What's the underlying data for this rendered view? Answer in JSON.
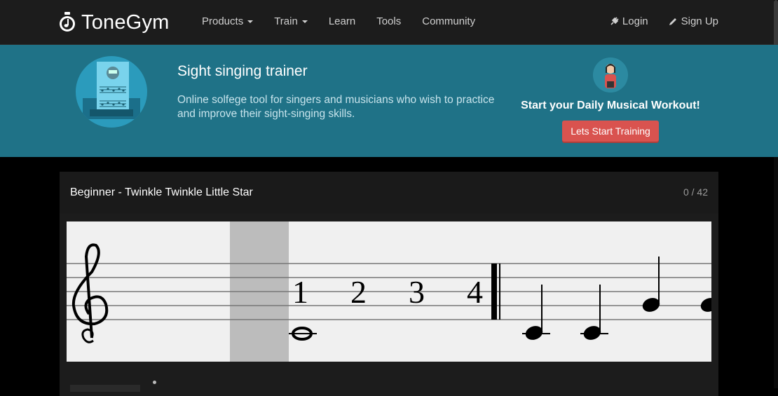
{
  "brand": {
    "name": "ToneGym",
    "icon": "stopwatch-music-note-icon"
  },
  "nav": {
    "items": [
      {
        "label": "Products",
        "dropdown": true
      },
      {
        "label": "Train",
        "dropdown": true
      },
      {
        "label": "Learn",
        "dropdown": false
      },
      {
        "label": "Tools",
        "dropdown": false
      },
      {
        "label": "Community",
        "dropdown": false
      }
    ],
    "login": "Login",
    "signup": "Sign Up"
  },
  "hero": {
    "title": "Sight singing trainer",
    "description": "Online solfege tool for singers and musicians who wish to practice and improve their sight-singing skills.",
    "workout_text": "Start your Daily Musical Workout!",
    "cta_label": "Lets Start Training"
  },
  "exercise": {
    "title": "Beginner - Twinkle Twinkle Little Star",
    "counter": "0 / 42",
    "count_in": [
      "1",
      "2",
      "3",
      "4"
    ]
  },
  "colors": {
    "navbar": "#1c1c1c",
    "hero": "#1f7287",
    "cta": "#d9534f",
    "panel": "#1c1c1c",
    "staff_bg": "#f0f0f0"
  }
}
